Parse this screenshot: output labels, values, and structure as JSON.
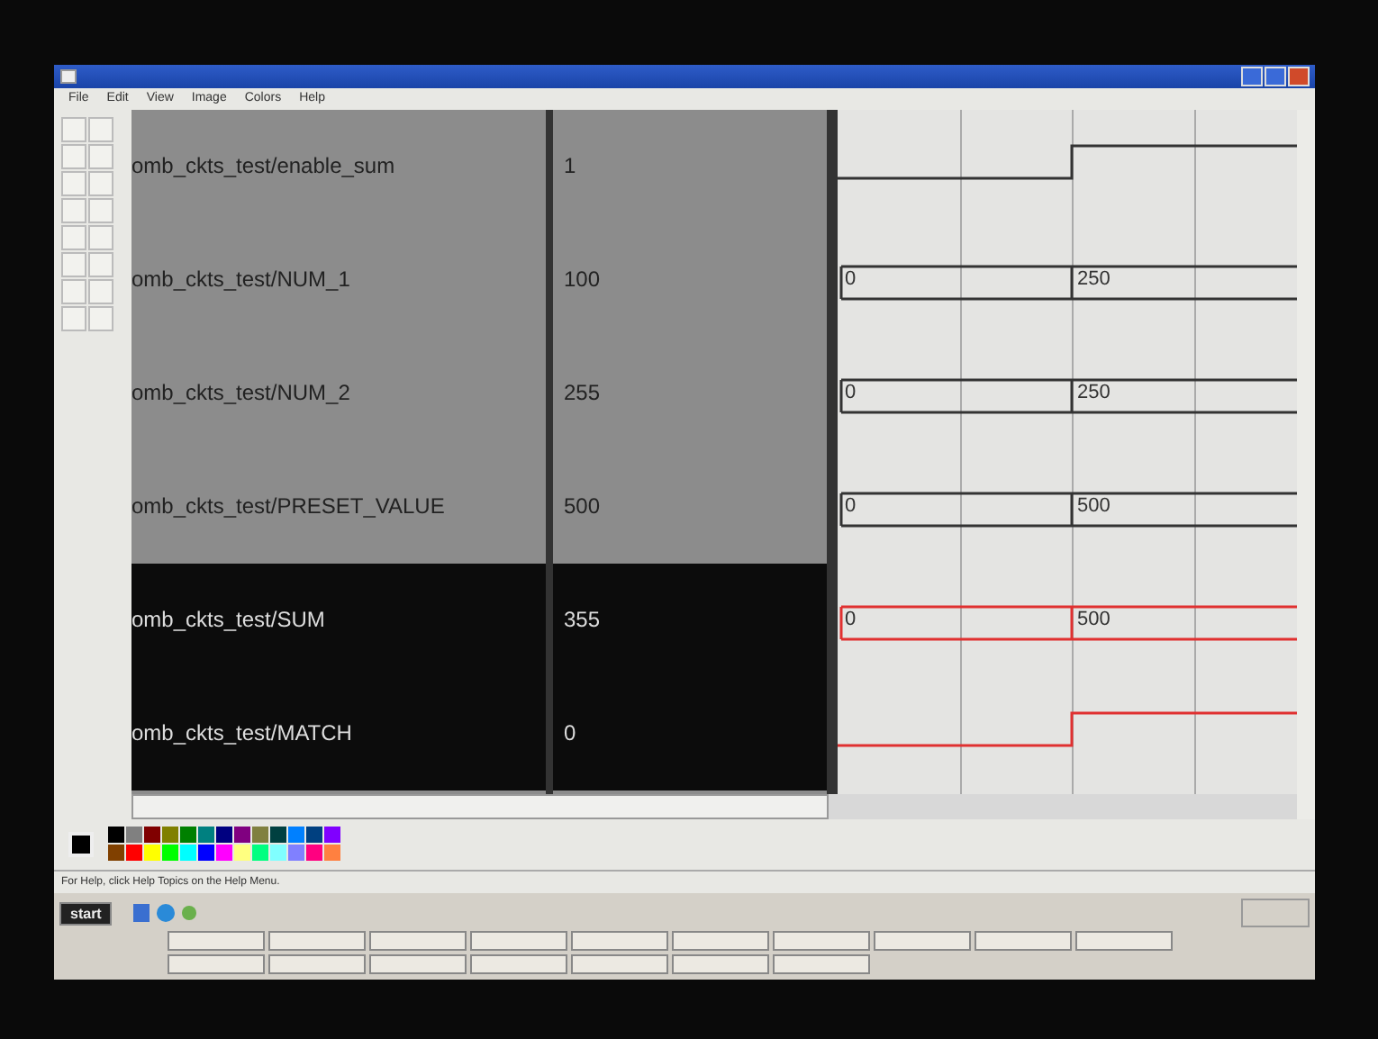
{
  "menu": [
    "File",
    "Edit",
    "View",
    "Image",
    "Colors",
    "Help"
  ],
  "signals": [
    {
      "name": "omb_ckts_test/enable_sum",
      "value": "1",
      "kind": "bit",
      "selected": false
    },
    {
      "name": "omb_ckts_test/NUM_1",
      "value": "100",
      "kind": "bus",
      "selected": false,
      "segments": [
        "0",
        "250"
      ]
    },
    {
      "name": "omb_ckts_test/NUM_2",
      "value": "255",
      "kind": "bus",
      "selected": false,
      "segments": [
        "0",
        "250"
      ]
    },
    {
      "name": "omb_ckts_test/PRESET_VALUE",
      "value": "500",
      "kind": "bus",
      "selected": false,
      "segments": [
        "0",
        "500"
      ]
    },
    {
      "name": "omb_ckts_test/SUM",
      "value": "355",
      "kind": "bus",
      "selected": true,
      "segments": [
        "0",
        "500"
      ]
    },
    {
      "name": "omb_ckts_test/MATCH",
      "value": "0",
      "kind": "bit",
      "selected": true
    }
  ],
  "palette": [
    {
      "color": "#000000"
    },
    {
      "color": "#808080"
    },
    {
      "color": "#800000"
    },
    {
      "color": "#808000"
    },
    {
      "color": "#008000"
    },
    {
      "color": "#008080"
    },
    {
      "color": "#000080"
    },
    {
      "color": "#800080"
    },
    {
      "color": "#808040"
    },
    {
      "color": "#004040"
    },
    {
      "color": "#0080ff"
    },
    {
      "color": "#004080"
    },
    {
      "color": "#8000ff"
    },
    {
      "color": "#804000"
    },
    {
      "color": "#ff0000"
    },
    {
      "color": "#ffff00"
    },
    {
      "color": "#00ff00"
    },
    {
      "color": "#00ffff"
    },
    {
      "color": "#0000ff"
    },
    {
      "color": "#ff00ff"
    },
    {
      "color": "#ffff80"
    },
    {
      "color": "#00ff80"
    },
    {
      "color": "#80ffff"
    },
    {
      "color": "#8080ff"
    },
    {
      "color": "#ff0080"
    },
    {
      "color": "#ff8040"
    }
  ],
  "status": "For Help, click Help Topics on the Help Menu.",
  "start": "start"
}
